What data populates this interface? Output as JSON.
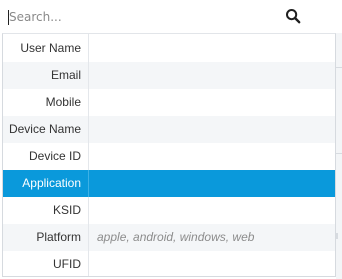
{
  "search": {
    "placeholder": "Search...",
    "value": ""
  },
  "icons": {
    "search": "magnifier-icon"
  },
  "colors": {
    "selected_background": "#0a99db",
    "selected_text": "#ffffff",
    "alternate_row": "#f4f6f8",
    "hint_text": "#8c8c8c"
  },
  "fields": [
    {
      "label": "User Name",
      "hint": ""
    },
    {
      "label": "Email",
      "hint": ""
    },
    {
      "label": "Mobile",
      "hint": ""
    },
    {
      "label": "Device Name",
      "hint": ""
    },
    {
      "label": "Device ID",
      "hint": ""
    },
    {
      "label": "Application",
      "hint": ""
    },
    {
      "label": "KSID",
      "hint": ""
    },
    {
      "label": "Platform",
      "hint": "apple, android, windows, web"
    },
    {
      "label": "UFID",
      "hint": ""
    }
  ],
  "selected_field": "Application"
}
